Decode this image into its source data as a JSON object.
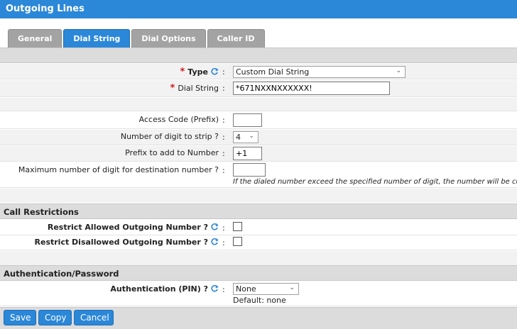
{
  "window": {
    "title": "Outgoing Lines"
  },
  "tabs": [
    {
      "label": "General"
    },
    {
      "label": "Dial String"
    },
    {
      "label": "Dial Options"
    },
    {
      "label": "Caller ID"
    }
  ],
  "form": {
    "colon": ":",
    "type": {
      "label": "Type",
      "required_mark": "*",
      "value": "Custom Dial String"
    },
    "dial_string": {
      "label": "Dial String",
      "required_mark": "*",
      "value": "*671NXXNXXXXXX!"
    },
    "access_code": {
      "label": "Access Code (Prefix)",
      "value": ""
    },
    "digits_strip": {
      "label": "Number of digit to strip ?",
      "value": "4"
    },
    "prefix_add": {
      "label": "Prefix to add to Number",
      "value": "+1"
    },
    "max_digits": {
      "label": "Maximum number of digit for destination number ?",
      "value": "",
      "note": "If the dialed number exceed the specified number of digit, the number will be cut."
    }
  },
  "call_restrictions": {
    "title": "Call Restrictions",
    "allowed": {
      "label": "Restrict Allowed Outgoing Number ?",
      "checked": false
    },
    "disallowed": {
      "label": "Restrict Disallowed Outgoing Number ?",
      "checked": false
    }
  },
  "authentication": {
    "title": "Authentication/Password",
    "pin": {
      "label": "Authentication (PIN) ?",
      "value": "None",
      "default_text": "Default: none"
    }
  },
  "buttons": {
    "save": "Save",
    "copy": "Copy",
    "cancel": "Cancel"
  },
  "colors": {
    "accent": "#2b87d8",
    "tab_inactive": "#a3a3a3",
    "required": "#d41c1c",
    "section_bg": "#dcdcdc"
  }
}
